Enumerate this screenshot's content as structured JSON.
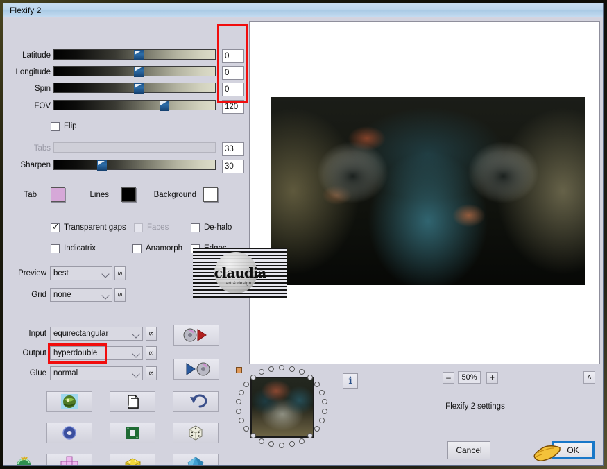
{
  "window": {
    "title": "Flexify 2"
  },
  "sliders": [
    {
      "label": "Latitude",
      "value": "0",
      "pos": 52,
      "disabled": false
    },
    {
      "label": "Longitude",
      "value": "0",
      "pos": 52,
      "disabled": false
    },
    {
      "label": "Spin",
      "value": "0",
      "pos": 52,
      "disabled": false
    },
    {
      "label": "FOV",
      "value": "120",
      "pos": 67,
      "disabled": false
    }
  ],
  "tabs_row": {
    "label": "Tabs",
    "value": "33",
    "disabled": true
  },
  "sharpen_row": {
    "label": "Sharpen",
    "value": "30",
    "pos": 28,
    "disabled": false
  },
  "flip": {
    "label": "Flip",
    "checked": false
  },
  "colors": [
    {
      "label": "Tab",
      "hex": "#d6a8d8"
    },
    {
      "label": "Lines",
      "hex": "#000000"
    },
    {
      "label": "Background",
      "hex": "#ffffff"
    }
  ],
  "checkboxes": [
    {
      "label": "Transparent gaps",
      "checked": true,
      "disabled": false
    },
    {
      "label": "Faces",
      "checked": false,
      "disabled": true
    },
    {
      "label": "De-halo",
      "checked": false,
      "disabled": false
    },
    {
      "label": "Indicatrix",
      "checked": false,
      "disabled": false
    },
    {
      "label": "Anamorph",
      "checked": false,
      "disabled": false
    },
    {
      "label": "Edges",
      "checked": false,
      "disabled": false
    }
  ],
  "selects": [
    {
      "label": "Preview",
      "value": "best",
      "side_button": "s"
    },
    {
      "label": "Grid",
      "value": "none",
      "side_button": "s"
    },
    {
      "label": "Input",
      "value": "equirectangular",
      "side_button": "s"
    },
    {
      "label": "Output",
      "value": "hyperdouble",
      "side_button": "s",
      "highlighted": true
    },
    {
      "label": "Glue",
      "value": "normal",
      "side_button": "s"
    }
  ],
  "preset_buttons": [
    {
      "name": "load-preset"
    },
    {
      "name": "save-preset"
    }
  ],
  "icon_grid": [
    {
      "name": "globe-thumbnail-button"
    },
    {
      "name": "copy-pages-button"
    },
    {
      "name": "undo-arrow-button"
    },
    {
      "name": "torus-button"
    },
    {
      "name": "square-frame-button"
    },
    {
      "name": "dice-button"
    },
    {
      "name": "cross-net-button"
    },
    {
      "name": "cube-button"
    },
    {
      "name": "polyhedron-button"
    }
  ],
  "toolbar": {
    "info_label": "i",
    "zoom_out_label": "–",
    "zoom_value": "50%",
    "zoom_in_label": "+",
    "collapse_label": "ʌ",
    "settings_label": "Flexify 2 settings"
  },
  "dialog": {
    "cancel_label": "Cancel",
    "ok_label": "OK"
  },
  "accent": {
    "highlight_red": "#f10d0d",
    "focus_blue": "#1878c8"
  },
  "watermark": {
    "text": "claudia",
    "subtext": "art & design"
  }
}
